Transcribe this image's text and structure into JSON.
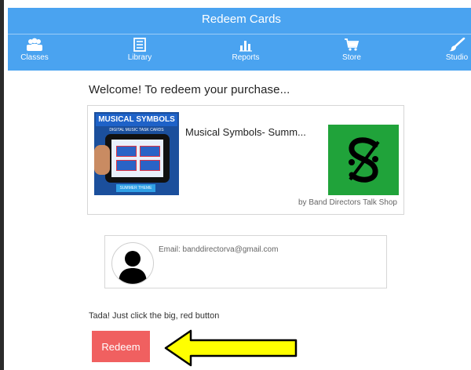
{
  "header": {
    "title": "Redeem Cards"
  },
  "nav": {
    "items": [
      {
        "label": "Classes",
        "icon": "users-icon"
      },
      {
        "label": "Library",
        "icon": "library-icon"
      },
      {
        "label": "Reports",
        "icon": "bar-chart-icon"
      },
      {
        "label": "Store",
        "icon": "cart-icon"
      },
      {
        "label": "Studio",
        "icon": "brush-icon"
      }
    ]
  },
  "main": {
    "welcome": "Welcome! To redeem your purchase...",
    "product": {
      "name": "Musical Symbols- Summ...",
      "thumb_title": "MUSICAL SYMBOLS",
      "thumb_subtitle": "DIGITAL MUSIC TASK CARDS",
      "thumb_footer": "SUMMER THEME",
      "seller": "by Band Directors Talk Shop"
    },
    "account": {
      "email": "Email: banddirectorva@gmail.com"
    },
    "instruction": "Tada! Just click the big, red button",
    "redeem_label": "Redeem"
  },
  "colors": {
    "header_bg": "#4aa3f0",
    "redeem_bg": "#f06060",
    "arrow_fill": "#ffff00",
    "seller_logo_bg": "#20a33a"
  }
}
